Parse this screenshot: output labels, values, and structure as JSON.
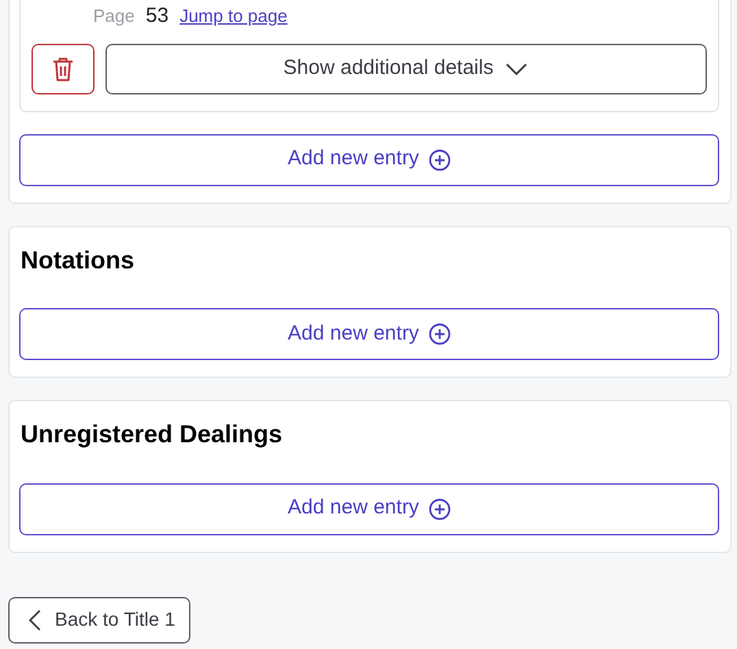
{
  "sections": [
    {
      "entries": [
        {
          "page_label": "Page",
          "page_number": "53",
          "jump_link": "Jump to page",
          "details_button": "Show additional details",
          "expanded": false
        }
      ],
      "add_button": "Add new entry"
    },
    {
      "title": "Notations",
      "add_button": "Add new entry"
    },
    {
      "title": "Unregistered Dealings",
      "add_button": "Add new entry"
    }
  ],
  "back_button": "Back to Title 1"
}
